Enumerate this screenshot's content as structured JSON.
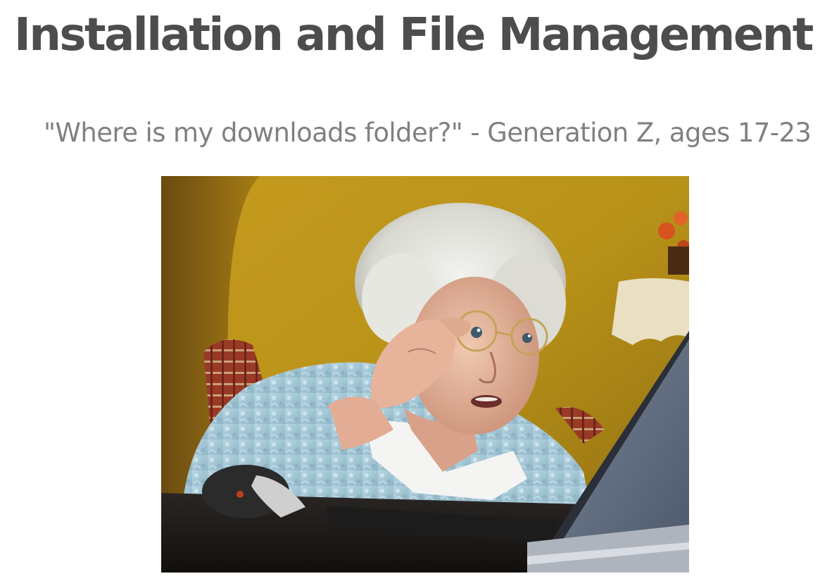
{
  "slide": {
    "title": "Installation and File Management",
    "quote": "\"Where is my downloads folder?\" - Generation Z, ages 17-23"
  },
  "photo": {
    "subject": "elderly woman peering at laptop screen through glasses",
    "icon": "photo-image"
  },
  "colors": {
    "title": "#4d4d4d",
    "quote": "#808080",
    "wall": "#c49a1e",
    "sweater": "#a9cbd8",
    "laptop": "#5b6878"
  }
}
